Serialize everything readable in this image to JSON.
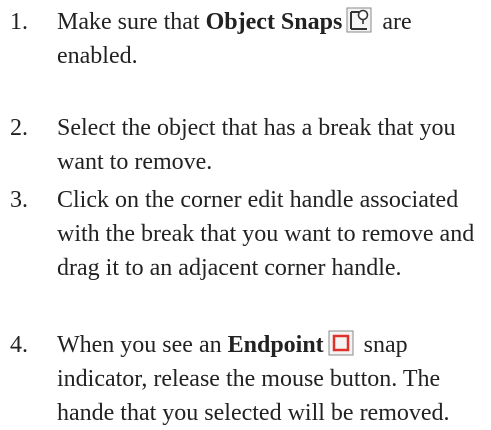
{
  "steps": [
    {
      "number": "1.",
      "before": "Make sure that ",
      "bold": "Object Snaps",
      "icon": "object-snaps-icon",
      "after": " are enabled."
    },
    {
      "number": "2.",
      "text": "Select the object that has a break that you want to remove."
    },
    {
      "number": "3.",
      "text": "Click on the corner edit handle associated with the break that you want to remove and drag it to an adjacent corner handle."
    },
    {
      "number": "4.",
      "before": "When you see an ",
      "bold": "Endpoint",
      "icon": "endpoint-snap-icon",
      "after": " snap indicator, release the mouse button. The hande that you selected will be removed."
    }
  ],
  "colors": {
    "text": "#222222",
    "endpoint_icon": "#e0302a",
    "icon_frame": "#8a8a8a"
  }
}
